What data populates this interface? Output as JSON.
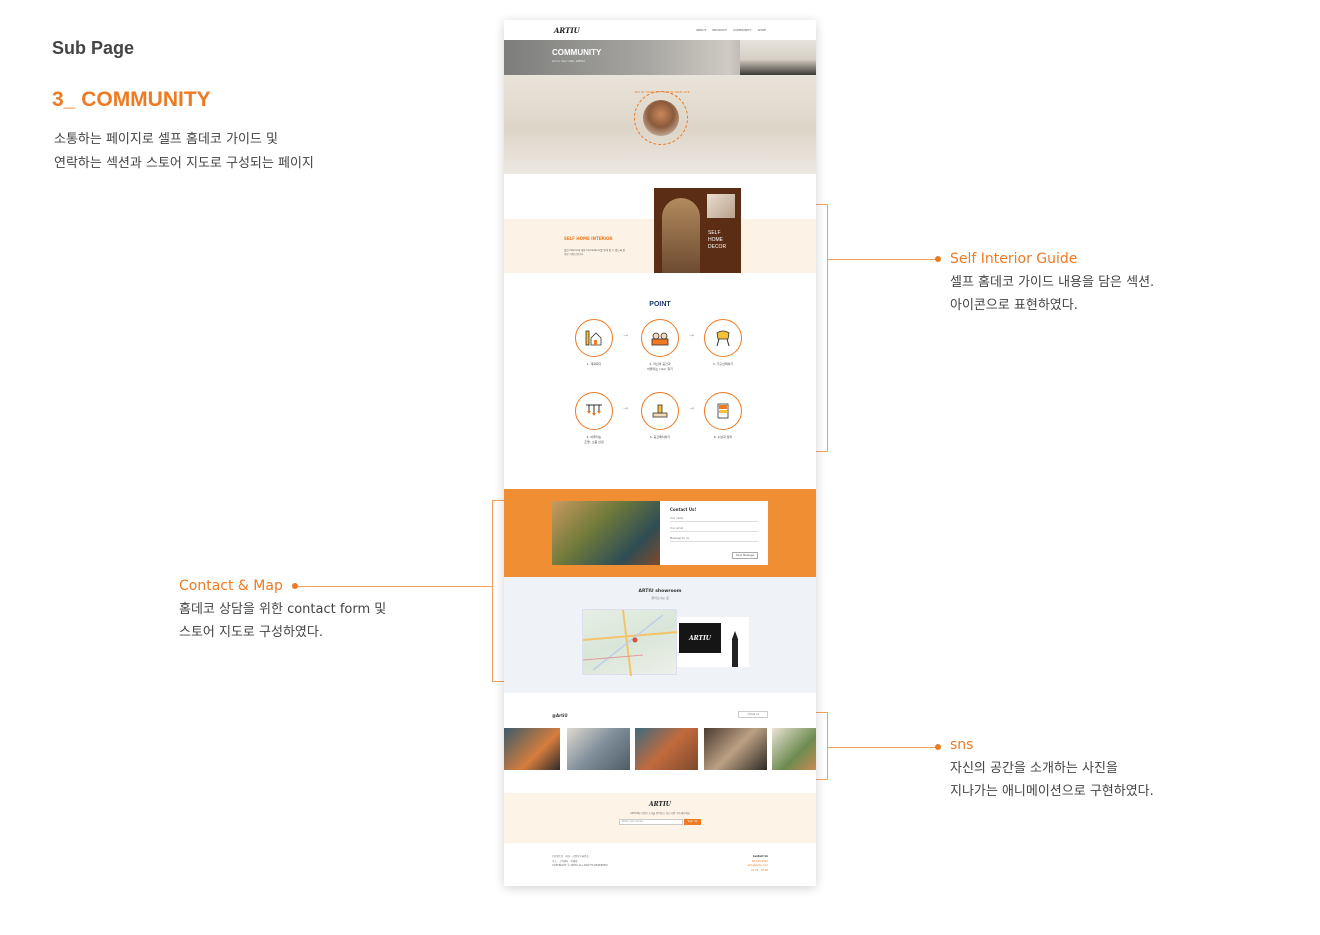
{
  "header": {
    "sub_page": "Sub Page",
    "title": "3_ COMMUNITY",
    "desc_line1": "소통하는 페이지로 셀프 홈데코 가이드 및",
    "desc_line2": "연락하는 섹션과 스토어 지도로 구성되는 페이지"
  },
  "annotations": {
    "self_interior": {
      "title": "Self Interior Guide",
      "line1": "셀프 홈데코 가이드 내용을 담은 섹션.",
      "line2": "아이콘으로 표현하였다."
    },
    "contact_map": {
      "title": "Contact & Map",
      "line1": "홈데코 상담을 위한 contact form 및",
      "line2": "스토어 지도로 구성하였다."
    },
    "sns": {
      "title": "sns",
      "line1": "자신의 공간을 소개하는 사진을",
      "line2": "지나가는 애니메이션으로 구현하였다."
    }
  },
  "mock": {
    "logo": "ARTIU",
    "nav": [
      "ABOUT",
      "PRODUCT",
      "COMMUNITY",
      "SHOP"
    ],
    "hero": {
      "title": "COMMUNITY",
      "subtitle": "Art In Your Life, ARTIU"
    },
    "badge_text": "ART IN YOUR LIFE · ART IN YOUR LIFE",
    "self": {
      "title": "SELF HOME INTERIOR",
      "text": "셀프interior에 대한 homedecor를 쉽게 알 수 있도록 정리한 가이드입니다.",
      "card_line1": "SELF",
      "card_line2": "HOME",
      "card_line3": "DECOR"
    },
    "point": {
      "title": "POINT",
      "steps": [
        {
          "line1": "1. 계획짜기",
          "line2": ""
        },
        {
          "line1": "2. 자신의 공간과",
          "line2": "어울리는 color 찾기"
        },
        {
          "line1": "3. 가구선택하기",
          "line2": ""
        },
        {
          "line1": "4. 어울리는",
          "line2": "조명, 소품 선정"
        },
        {
          "line1": "5. 공간배치하기",
          "line2": ""
        },
        {
          "line1": "6. 수납과 정리",
          "line2": ""
        }
      ]
    },
    "contact": {
      "title": "Contact Us!",
      "field_name": "Your name",
      "field_email": "Your email",
      "field_message": "Message for us",
      "button": "Send Message"
    },
    "map": {
      "title": "ARTIU showroom",
      "sub": "찾아오시는 길",
      "sign": "ARTIU"
    },
    "sns": {
      "handle": "@ArtiU",
      "follow": "Follow us"
    },
    "newsletter": {
      "logo": "ARTIU",
      "text": "ARTIU의 다양한 소식을 받아보고 싶으시면 구독해주세요",
      "placeholder": "Enter your email",
      "button": "Sign Up"
    },
    "footer": {
      "line1": "(주)아트유 · 대표 · 사업자등록번호",
      "line2": "주소 · 고객센터 · 이메일",
      "line3": "COPYRIGHT © ARTIU ALL RIGHTS RESERVED.",
      "cs_title": "Contact Us",
      "cs_phone": "02-123-4567",
      "cs_mail": "artiu@artiu.com",
      "cs_hours": "10:00 - 18:00"
    }
  }
}
